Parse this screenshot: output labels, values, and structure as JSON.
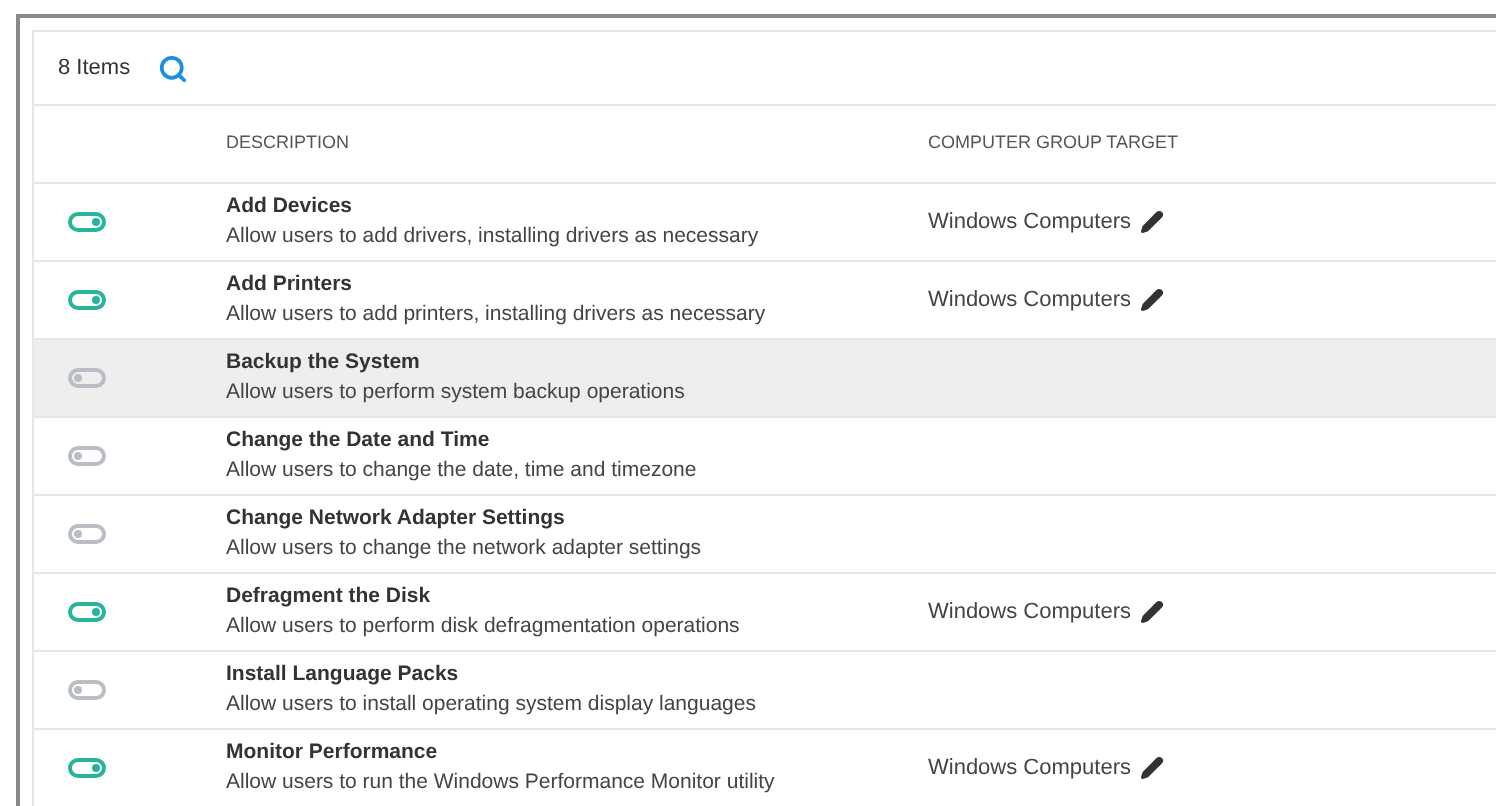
{
  "toolbar": {
    "count": "8 Items"
  },
  "table": {
    "columns": [
      "DESCRIPTION",
      "COMPUTER GROUP TARGET"
    ],
    "rows": [
      {
        "title": "Add Devices",
        "description": "Allow users to add drivers, installing drivers as necessary",
        "on": true,
        "selected": false,
        "target": "Windows Computers"
      },
      {
        "title": "Add Printers",
        "description": "Allow users to add printers, installing drivers as necessary",
        "on": true,
        "selected": false,
        "target": "Windows Computers"
      },
      {
        "title": "Backup the System",
        "description": "Allow users to perform system backup operations",
        "on": false,
        "selected": true
      },
      {
        "title": "Change the Date and Time",
        "description": "Allow users to change the date, time and timezone",
        "on": false,
        "selected": false
      },
      {
        "title": "Change Network Adapter Settings",
        "description": "Allow users to change the network adapter settings",
        "on": false,
        "selected": false
      },
      {
        "title": "Defragment the Disk",
        "description": "Allow users to perform disk defragmentation operations",
        "on": true,
        "selected": false,
        "target": "Windows Computers"
      },
      {
        "title": "Install Language Packs",
        "description": "Allow users to install operating system display languages",
        "on": false,
        "selected": false
      },
      {
        "title": "Monitor Performance",
        "description": "Allow users to run the Windows Performance Monitor utility",
        "on": true,
        "selected": false,
        "target": "Windows Computers"
      }
    ]
  }
}
